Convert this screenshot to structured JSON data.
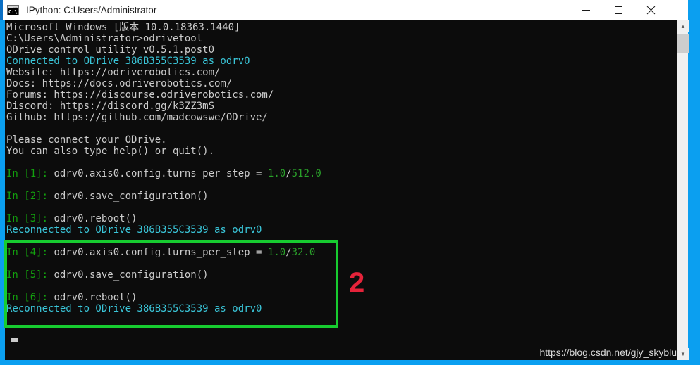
{
  "window": {
    "title": "IPython: C:Users/Administrator",
    "icon": "console-icon",
    "icon_glyph": "C:\\",
    "controls": {
      "minimize": "minimize-icon",
      "maximize": "maximize-icon",
      "close": "close-icon"
    },
    "border_color": "#0b9ff0",
    "titlebar_background": "#ffffff"
  },
  "terminal": {
    "background": "#0c0c0c",
    "default_color": "#cccccc",
    "cyan_color": "#3ac5d8",
    "green_color": "#13a10e",
    "number_color": "#2aa02a",
    "lines": [
      {
        "id": "l01",
        "segments": [
          {
            "text": "Microsoft Windows [版本 10.0.18363.1440]",
            "color": "white"
          }
        ]
      },
      {
        "id": "l02",
        "segments": [
          {
            "text": "C:\\Users\\Administrator>odrivetool",
            "color": "white"
          }
        ]
      },
      {
        "id": "l03",
        "segments": [
          {
            "text": "ODrive control utility v0.5.1.post0",
            "color": "white"
          }
        ]
      },
      {
        "id": "l04",
        "segments": [
          {
            "text": "Connected to ODrive 386B355C3539 as odrv0",
            "color": "cyan"
          }
        ]
      },
      {
        "id": "l05",
        "segments": [
          {
            "text": "Website: https://odriverobotics.com/",
            "color": "white"
          }
        ]
      },
      {
        "id": "l06",
        "segments": [
          {
            "text": "Docs: https://docs.odriverobotics.com/",
            "color": "white"
          }
        ]
      },
      {
        "id": "l07",
        "segments": [
          {
            "text": "Forums: https://discourse.odriverobotics.com/",
            "color": "white"
          }
        ]
      },
      {
        "id": "l08",
        "segments": [
          {
            "text": "Discord: https://discord.gg/k3ZZ3mS",
            "color": "white"
          }
        ]
      },
      {
        "id": "l09",
        "segments": [
          {
            "text": "Github: https://github.com/madcowswe/ODrive/",
            "color": "white"
          }
        ]
      },
      {
        "id": "l10",
        "segments": [
          {
            "text": "",
            "color": "white"
          }
        ]
      },
      {
        "id": "l11",
        "segments": [
          {
            "text": "Please connect your ODrive.",
            "color": "white"
          }
        ]
      },
      {
        "id": "l12",
        "segments": [
          {
            "text": "You can also type help() or quit().",
            "color": "white"
          }
        ]
      },
      {
        "id": "l13",
        "segments": [
          {
            "text": "",
            "color": "white"
          }
        ]
      },
      {
        "id": "l14",
        "segments": [
          {
            "text": "In [1]:",
            "color": "green"
          },
          {
            "text": " odrv0.axis0.config.turns_per_step = ",
            "color": "white"
          },
          {
            "text": "1.0",
            "color": "num"
          },
          {
            "text": "/",
            "color": "white"
          },
          {
            "text": "512.0",
            "color": "num"
          }
        ]
      },
      {
        "id": "l15",
        "segments": [
          {
            "text": "",
            "color": "white"
          }
        ]
      },
      {
        "id": "l16",
        "segments": [
          {
            "text": "In [2]:",
            "color": "green"
          },
          {
            "text": " odrv0.save_configuration()",
            "color": "white"
          }
        ]
      },
      {
        "id": "l17",
        "segments": [
          {
            "text": "",
            "color": "white"
          }
        ]
      },
      {
        "id": "l18",
        "segments": [
          {
            "text": "In [3]:",
            "color": "green"
          },
          {
            "text": " odrv0.reboot()",
            "color": "white"
          }
        ]
      },
      {
        "id": "l19",
        "segments": [
          {
            "text": "Reconnected to ODrive 386B355C3539 as odrv0",
            "color": "cyan"
          }
        ]
      },
      {
        "id": "l20",
        "segments": [
          {
            "text": "",
            "color": "white"
          }
        ]
      },
      {
        "id": "l21",
        "segments": [
          {
            "text": "In [4]:",
            "color": "green"
          },
          {
            "text": " odrv0.axis0.config.turns_per_step = ",
            "color": "white"
          },
          {
            "text": "1.0",
            "color": "num"
          },
          {
            "text": "/",
            "color": "white"
          },
          {
            "text": "32.0",
            "color": "num"
          }
        ]
      },
      {
        "id": "l22",
        "segments": [
          {
            "text": "",
            "color": "white"
          }
        ]
      },
      {
        "id": "l23",
        "segments": [
          {
            "text": "In [5]:",
            "color": "green"
          },
          {
            "text": " odrv0.save_configuration()",
            "color": "white"
          }
        ]
      },
      {
        "id": "l24",
        "segments": [
          {
            "text": "",
            "color": "white"
          }
        ]
      },
      {
        "id": "l25",
        "segments": [
          {
            "text": "In [6]:",
            "color": "green"
          },
          {
            "text": " odrv0.reboot()",
            "color": "white"
          }
        ]
      },
      {
        "id": "l26",
        "segments": [
          {
            "text": "Reconnected to ODrive 386B355C3539 as odrv0",
            "color": "cyan"
          }
        ]
      }
    ]
  },
  "scrollbar": {
    "up_arrow": "chevron-up-icon",
    "down_arrow": "chevron-down-icon",
    "up_glyph": "▲",
    "down_glyph": "▼"
  },
  "annotation": {
    "label": "2",
    "box_color": "#17cc30",
    "label_color": "#e5233a"
  },
  "watermark": {
    "text": "https://blog.csdn.net/gjy_skyblu"
  }
}
